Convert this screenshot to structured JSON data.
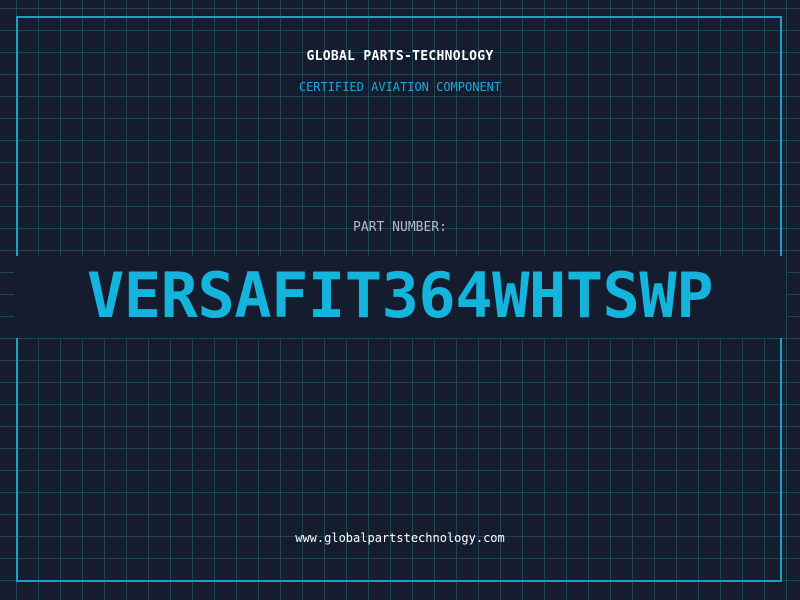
{
  "header": {
    "company": "GLOBAL PARTS-TECHNOLOGY",
    "tagline": "CERTIFIED AVIATION COMPONENT"
  },
  "part": {
    "label": "PART NUMBER:",
    "number": "VERSAFIT364WHTSWP"
  },
  "footer": {
    "website": "www.globalpartstechnology.com"
  },
  "colors": {
    "background": "#141c2e",
    "grid": "#1f4557",
    "accent": "#1a9fc6",
    "part_number": "#14b4dc"
  }
}
